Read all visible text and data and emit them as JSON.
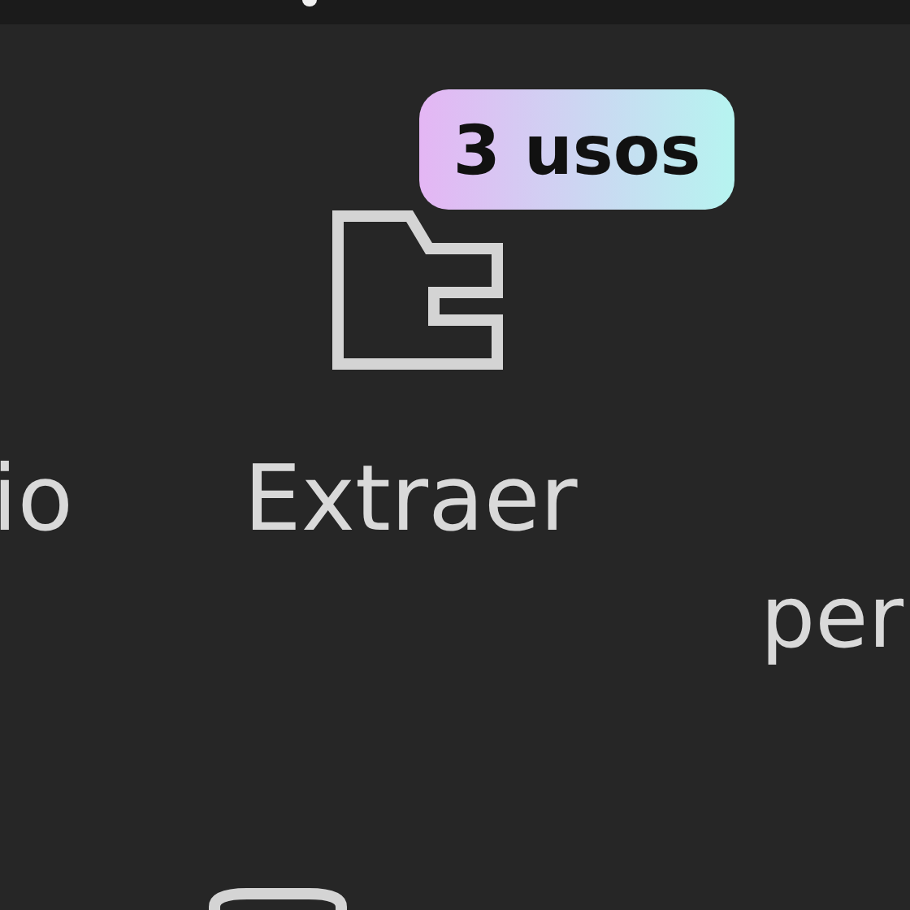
{
  "tiles": [
    {
      "label": "io"
    },
    {
      "label": "Extraer",
      "badge": "3 usos"
    },
    {
      "label": "per"
    }
  ]
}
